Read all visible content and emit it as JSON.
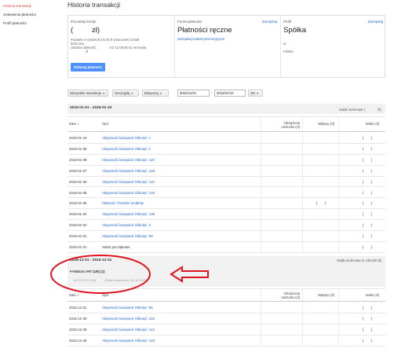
{
  "sidebar": {
    "items": [
      {
        "label": "Historia transakcji",
        "active": true
      },
      {
        "label": "Ustawienia płatności",
        "active": false
      },
      {
        "label": "Profil płatności",
        "active": false
      }
    ]
  },
  "page_title": "Historia transakcji",
  "summary": {
    "credit": {
      "label": "Pozostały kredyt",
      "amount_open": "(",
      "amount_currency": "zł)",
      "note1": "Podatek w wysokości 0,00 zł (szacunek) został",
      "note2": "doliczony",
      "note3_label": "Ostatnia płatność",
      "note3_value": "-01-12 08:06:41 na kwotę",
      "note4": "zł",
      "pay_button": "Dokonaj płatności"
    },
    "payment_form": {
      "label": "Forma płatności",
      "change_link": "Zarządzaj",
      "value": "Płatności ręczne",
      "codes_link": "Zarządzaj kodami promocyjnymi"
    },
    "profile": {
      "label": "Profil",
      "change_link": "Zarządzaj",
      "value": "Spółka",
      "line1": "ul.",
      "line2": "Polska"
    }
  },
  "toolbar": {
    "filter_all": "Wszystkie transakcje",
    "details": "Szczegóły",
    "export": "Eksportuj",
    "date_from": "2015/11/01",
    "date_sep": "-",
    "date_to": "2016/01/10",
    "ok": "OK"
  },
  "table1": {
    "period": "2016-01-01 - 2016-01-10",
    "closing_label": "Saldo końcowe (",
    "closing_suffix": "zł)",
    "headers": {
      "date": "Data",
      "desc": "Opis",
      "charges_1": "Obciążenia",
      "charges_2": "rachunku (zł)",
      "credits": "Wpływy (zł)",
      "balance": "Saldo (zł)"
    },
    "rows": [
      {
        "date": "2016-01-10",
        "desc": "Aktywność kampanii: Kliknięć: 1",
        "link": true,
        "charge": "",
        "credit": "",
        "balance": "(  )"
      },
      {
        "date": "2016-01-09",
        "desc": "Aktywność kampanii: Kliknięć: 1",
        "link": true,
        "charge": "",
        "credit": "",
        "balance": "(  )"
      },
      {
        "date": "2016-01-08",
        "desc": "Aktywność kampanii: Kliknięć: 110",
        "link": true,
        "charge": "",
        "credit": "",
        "balance": "(  )"
      },
      {
        "date": "2016-01-07",
        "desc": "Aktywność kampanii: Kliknięć: 128",
        "link": true,
        "charge": "",
        "credit": "",
        "balance": "(  )"
      },
      {
        "date": "2016-01-06",
        "desc": "Aktywność kampanii: Kliknięć: 110",
        "link": true,
        "charge": "",
        "credit": "",
        "balance": "(  )"
      },
      {
        "date": "2016-01-05",
        "desc": "Aktywność kampanii: Kliknięć: 140",
        "link": true,
        "charge": "",
        "credit": "",
        "balance": "(  )"
      },
      {
        "date": "2016-01-05",
        "desc": "Płatność: Transfer środków",
        "link": true,
        "charge": "",
        "credit": "(  )",
        "balance": "(  )"
      },
      {
        "date": "2016-01-04",
        "desc": "Aktywność kampanii: Kliknięć: 136",
        "link": true,
        "charge": "",
        "credit": "",
        "balance": "(  )"
      },
      {
        "date": "2016-01-03",
        "desc": "Aktywność kampanii: Kliknięć: 2",
        "link": true,
        "charge": "",
        "credit": "",
        "balance": "(  )"
      },
      {
        "date": "2016-01-01",
        "desc": "Aktywność kampanii: Kliknięć: 89",
        "link": true,
        "charge": "",
        "credit": "",
        "balance": "(  )"
      },
      {
        "date": "2016-01-01",
        "desc": "Saldo początkowe",
        "link": false,
        "charge": "",
        "credit": "",
        "balance": "(  )"
      }
    ]
  },
  "table2": {
    "period": "2015-12-01 - 2015-12-31",
    "closing_label": "Saldo końcowe (1 202,80 zł)",
    "invoice_title": "Faktura VAT (UE) (1)",
    "invoice_number": "18-07/15-10-116",
    "invoice_date": "(Data utworzenia: 31.12.2015)",
    "headers": {
      "date": "Data",
      "desc": "Opis",
      "charges_1": "Obciążenia",
      "charges_2": "rachunku (zł)",
      "credits": "Wpływy (zł)",
      "balance": "Saldo (zł)"
    },
    "rows": [
      {
        "date": "2015-12-31",
        "desc": "Aktywność kampanii: Kliknięć: 95",
        "link": true,
        "balance": "(  )"
      },
      {
        "date": "2015-12-30",
        "desc": "Aktywność kampanii: Kliknięć: 104",
        "link": true,
        "balance": "(  )"
      },
      {
        "date": "2015-12-29",
        "desc": "Aktywność kampanii: Kliknięć: 113",
        "link": true,
        "balance": "(  )"
      },
      {
        "date": "2015-12-28",
        "desc": "Aktywność kampanii: Kliknięć: 123",
        "link": true,
        "balance": "(  )"
      }
    ]
  },
  "colors": {
    "link": "#1a66c8",
    "active_nav": "#d14836",
    "button_blue": "#4d90fe",
    "annotation_red": "#e0141e"
  }
}
